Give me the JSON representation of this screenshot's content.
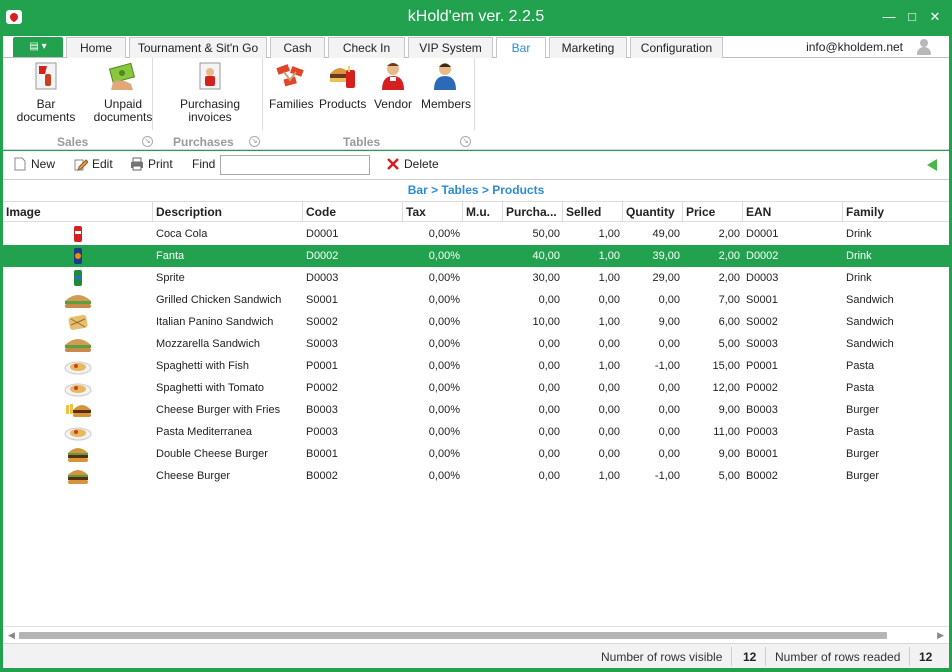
{
  "window": {
    "title": "kHold'em ver. 2.2.5"
  },
  "tabs": [
    {
      "label": "Home"
    },
    {
      "label": "Tournament & Sit'n Go"
    },
    {
      "label": "Cash"
    },
    {
      "label": "Check In"
    },
    {
      "label": "VIP System"
    },
    {
      "label": "Bar"
    },
    {
      "label": "Marketing"
    },
    {
      "label": "Configuration"
    }
  ],
  "active_tab": "Bar",
  "user_email": "info@kholdem.net",
  "ribbon": {
    "sales": {
      "label": "Sales",
      "buttons": [
        {
          "line1": "Bar documents",
          "line2": ""
        },
        {
          "line1": "Unpaid",
          "line2": "documents"
        }
      ]
    },
    "purchases": {
      "label": "Purchases",
      "buttons": [
        {
          "line1": "Purchasing",
          "line2": "invoices"
        }
      ]
    },
    "tables": {
      "label": "Tables",
      "buttons": [
        {
          "line1": "Families"
        },
        {
          "line1": "Products"
        },
        {
          "line1": "Vendor"
        },
        {
          "line1": "Members"
        }
      ]
    }
  },
  "toolbar": {
    "new": "New",
    "edit": "Edit",
    "print": "Print",
    "find": "Find",
    "find_value": "",
    "delete": "Delete"
  },
  "breadcrumb": "Bar > Tables > Products",
  "columns": [
    "Image",
    "Description",
    "Code",
    "Tax",
    "M.u.",
    "Purcha...",
    "Selled",
    "Quantity",
    "Price",
    "EAN",
    "Family"
  ],
  "rows": [
    {
      "image": "coca-cola-can",
      "description": "Coca Cola",
      "code": "D0001",
      "tax": "0,00%",
      "mu": "",
      "purchased": "50,00",
      "selled": "1,00",
      "quantity": "49,00",
      "price": "2,00",
      "ean": "D0001",
      "family": "Drink"
    },
    {
      "image": "fanta-can",
      "description": "Fanta",
      "code": "D0002",
      "tax": "0,00%",
      "mu": "",
      "purchased": "40,00",
      "selled": "1,00",
      "quantity": "39,00",
      "price": "2,00",
      "ean": "D0002",
      "family": "Drink"
    },
    {
      "image": "sprite-can",
      "description": "Sprite",
      "code": "D0003",
      "tax": "0,00%",
      "mu": "",
      "purchased": "30,00",
      "selled": "1,00",
      "quantity": "29,00",
      "price": "2,00",
      "ean": "D0003",
      "family": "Drink"
    },
    {
      "image": "sandwich",
      "description": "Grilled Chicken Sandwich",
      "code": "S0001",
      "tax": "0,00%",
      "mu": "",
      "purchased": "0,00",
      "selled": "0,00",
      "quantity": "0,00",
      "price": "7,00",
      "ean": "S0001",
      "family": "Sandwich"
    },
    {
      "image": "panino",
      "description": "Italian Panino Sandwich",
      "code": "S0002",
      "tax": "0,00%",
      "mu": "",
      "purchased": "10,00",
      "selled": "1,00",
      "quantity": "9,00",
      "price": "6,00",
      "ean": "S0002",
      "family": "Sandwich"
    },
    {
      "image": "sandwich",
      "description": "Mozzarella Sandwich",
      "code": "S0003",
      "tax": "0,00%",
      "mu": "",
      "purchased": "0,00",
      "selled": "0,00",
      "quantity": "0,00",
      "price": "5,00",
      "ean": "S0003",
      "family": "Sandwich"
    },
    {
      "image": "pasta-plate",
      "description": "Spaghetti with Fish",
      "code": "P0001",
      "tax": "0,00%",
      "mu": "",
      "purchased": "0,00",
      "selled": "1,00",
      "quantity": "-1,00",
      "price": "15,00",
      "ean": "P0001",
      "family": "Pasta"
    },
    {
      "image": "pasta-plate",
      "description": "Spaghetti with Tomato",
      "code": "P0002",
      "tax": "0,00%",
      "mu": "",
      "purchased": "0,00",
      "selled": "0,00",
      "quantity": "0,00",
      "price": "12,00",
      "ean": "P0002",
      "family": "Pasta"
    },
    {
      "image": "burger-fries",
      "description": "Cheese Burger with Fries",
      "code": "B0003",
      "tax": "0,00%",
      "mu": "",
      "purchased": "0,00",
      "selled": "0,00",
      "quantity": "0,00",
      "price": "9,00",
      "ean": "B0003",
      "family": "Burger"
    },
    {
      "image": "pasta-plate",
      "description": "Pasta Mediterranea",
      "code": "P0003",
      "tax": "0,00%",
      "mu": "",
      "purchased": "0,00",
      "selled": "0,00",
      "quantity": "0,00",
      "price": "11,00",
      "ean": "P0003",
      "family": "Pasta"
    },
    {
      "image": "burger",
      "description": "Double Cheese Burger",
      "code": "B0001",
      "tax": "0,00%",
      "mu": "",
      "purchased": "0,00",
      "selled": "0,00",
      "quantity": "0,00",
      "price": "9,00",
      "ean": "B0001",
      "family": "Burger"
    },
    {
      "image": "burger",
      "description": "Cheese Burger",
      "code": "B0002",
      "tax": "0,00%",
      "mu": "",
      "purchased": "0,00",
      "selled": "1,00",
      "quantity": "-1,00",
      "price": "5,00",
      "ean": "B0002",
      "family": "Burger"
    }
  ],
  "selected_row": 1,
  "status": {
    "visible_label": "Number of rows visible",
    "visible_count": "12",
    "readed_label": "Number of rows readed",
    "readed_count": "12"
  },
  "colors": {
    "accent": "#22a14f",
    "link": "#2c8bd4"
  }
}
